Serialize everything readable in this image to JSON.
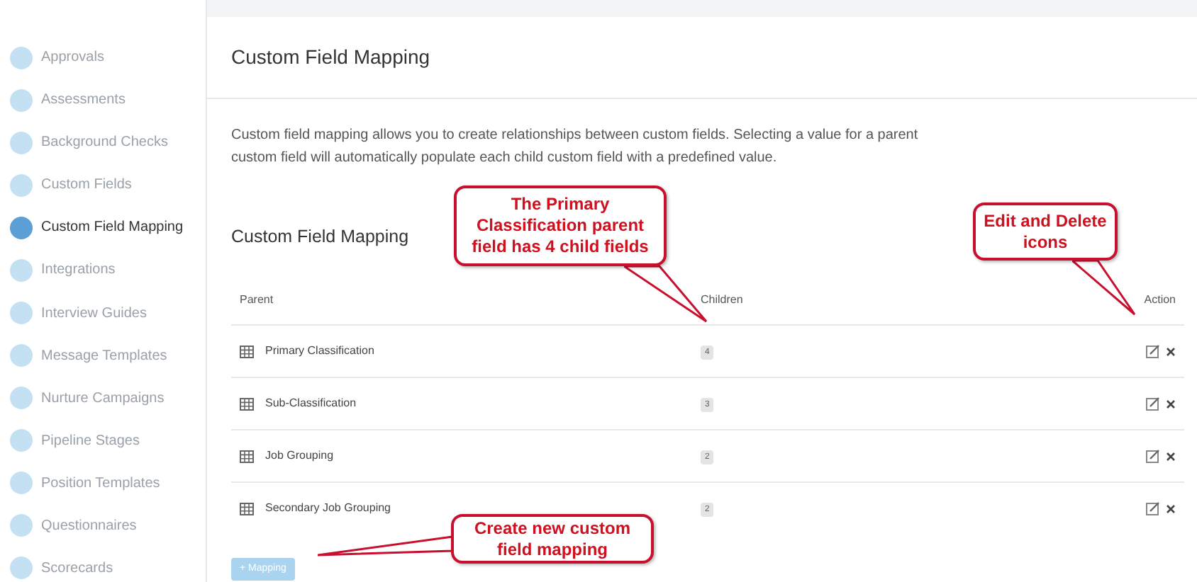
{
  "sidebar": {
    "items": [
      {
        "label": "Approvals",
        "selected": false
      },
      {
        "label": "Assessments",
        "selected": false
      },
      {
        "label": "Background Checks",
        "selected": false
      },
      {
        "label": "Custom Fields",
        "selected": false
      },
      {
        "label": "Custom Field Mapping",
        "selected": true
      },
      {
        "label": "Integrations",
        "selected": false
      },
      {
        "label": "Interview Guides",
        "selected": false
      },
      {
        "label": "Message Templates",
        "selected": false
      },
      {
        "label": "Nurture Campaigns",
        "selected": false
      },
      {
        "label": "Pipeline Stages",
        "selected": false
      },
      {
        "label": "Position Templates",
        "selected": false
      },
      {
        "label": "Questionnaires",
        "selected": false
      },
      {
        "label": "Scorecards",
        "selected": false
      }
    ]
  },
  "panel": {
    "title": "Custom Field Mapping",
    "description": "Custom field mapping allows you to create relationships between custom fields. Selecting a value for a parent custom field will automatically populate each child custom field with a predefined value.",
    "section_title": "Custom Field Mapping",
    "table": {
      "columns": [
        "Parent",
        "Children",
        "Action"
      ],
      "rows": [
        {
          "parent": "Primary Classification",
          "children": "4"
        },
        {
          "parent": "Sub-Classification",
          "children": "3"
        },
        {
          "parent": "Job Grouping",
          "children": "2"
        },
        {
          "parent": "Secondary Job Grouping",
          "children": "2"
        }
      ]
    },
    "add_button": "+ Mapping"
  },
  "callouts": [
    {
      "text": "The Primary Classification parent field has 4 child fields"
    },
    {
      "text": "Edit and Delete icons"
    },
    {
      "text": "Create new custom field mapping"
    }
  ]
}
